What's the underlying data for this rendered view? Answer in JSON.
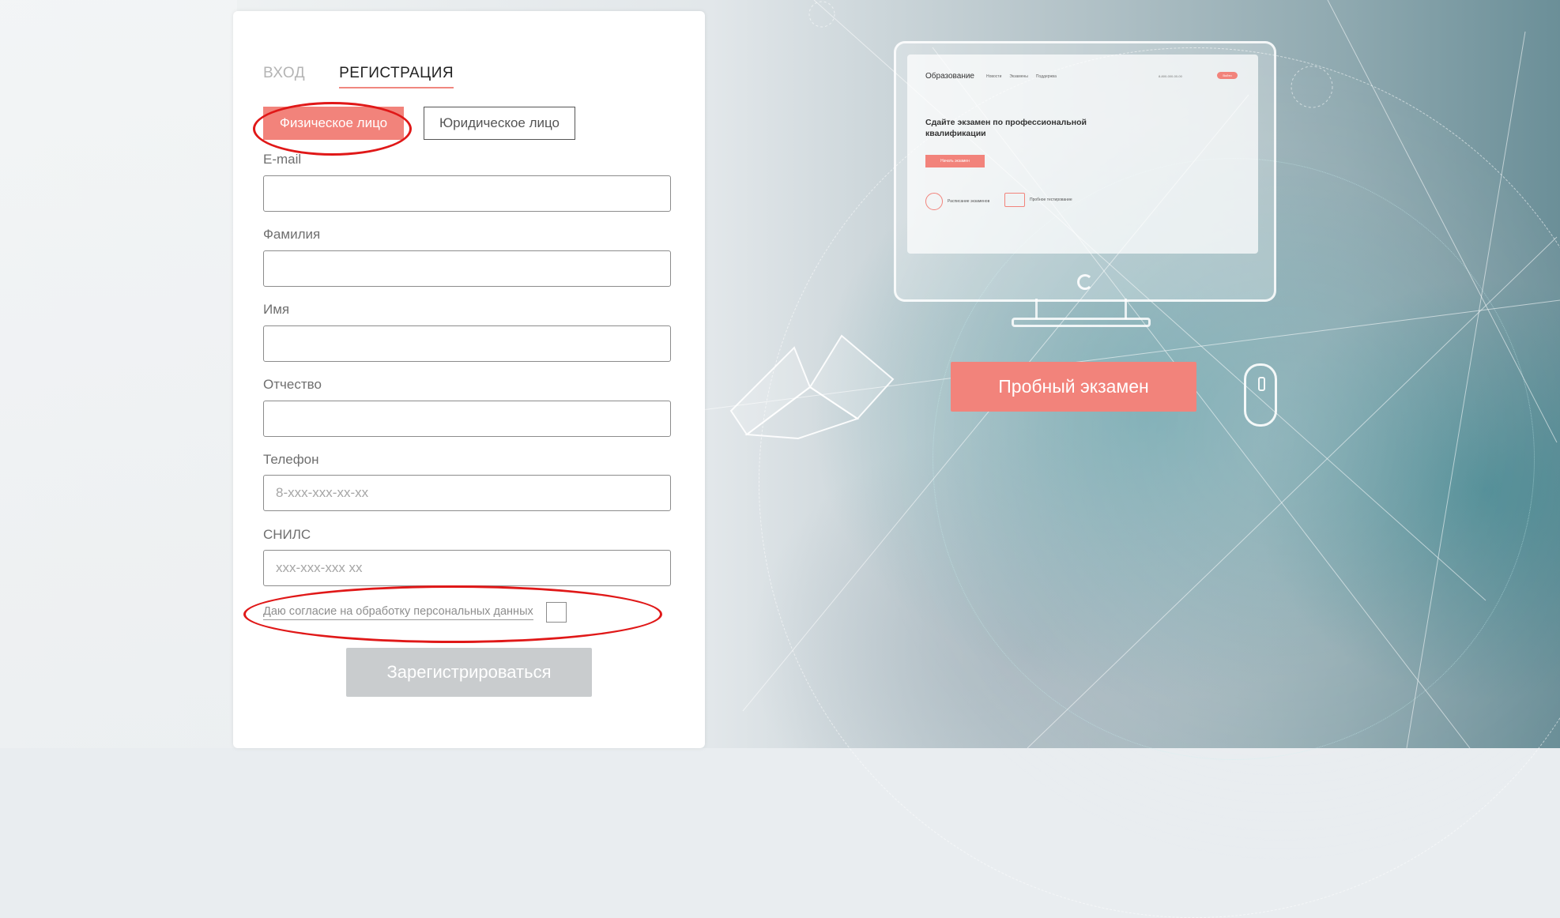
{
  "auth_tabs": {
    "login": "ВХОД",
    "register": "РЕГИСТРАЦИЯ"
  },
  "person_type": {
    "individual": "Физическое лицо",
    "legal": "Юридическое лицо",
    "selected": "Физическое лицо"
  },
  "form": {
    "email": {
      "label": "E-mail",
      "value": "",
      "placeholder": ""
    },
    "lastname": {
      "label": "Фамилия",
      "value": "",
      "placeholder": ""
    },
    "firstname": {
      "label": "Имя",
      "value": "",
      "placeholder": ""
    },
    "patronymic": {
      "label": "Отчество",
      "value": "",
      "placeholder": ""
    },
    "phone": {
      "label": "Телефон",
      "value": "",
      "placeholder": "8-xxx-xxx-xx-xx"
    },
    "snils": {
      "label": "СНИЛС",
      "value": "",
      "placeholder": "xxx-xxx-xxx xx"
    },
    "consent_text": "Даю согласие на обработку персональных данных",
    "consent_checked": false,
    "submit_label": "Зарегистрироваться"
  },
  "hero": {
    "trial_button": "Пробный экзамен",
    "screen": {
      "brand": "Образование",
      "nav": [
        "Новости",
        "Экзамены",
        "Поддержка"
      ],
      "phone": "8-800-000-00-00",
      "login_btn": "Войти",
      "title": "Сдайте экзамен по профессиональной квалификации",
      "cta": "Начать экзамен",
      "feature_1": "Расписание экзаменов",
      "feature_2": "Пробное тестирование"
    }
  },
  "colors": {
    "accent": "#f2837b",
    "annotation": "#e01818",
    "disabled_button": "#c9ccce"
  }
}
